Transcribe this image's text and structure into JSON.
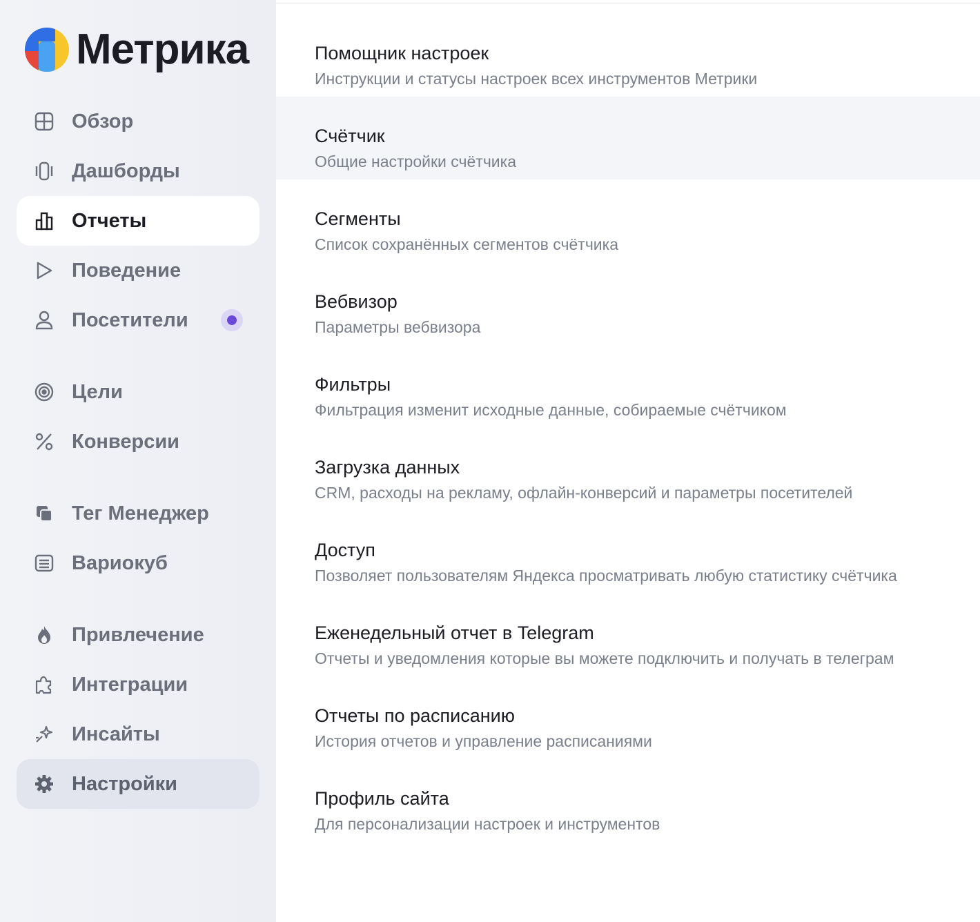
{
  "app": {
    "logo_text": "Метрика"
  },
  "sidebar": {
    "items": [
      {
        "label": "Обзор",
        "icon": "grid-icon"
      },
      {
        "label": "Дашборды",
        "icon": "dashboards-icon"
      },
      {
        "label": "Отчеты",
        "icon": "bar-chart-icon",
        "state": "active"
      },
      {
        "label": "Поведение",
        "icon": "play-icon"
      },
      {
        "label": "Посетители",
        "icon": "user-icon",
        "badge": true
      },
      {
        "label": "Цели",
        "icon": "target-icon"
      },
      {
        "label": "Конверсии",
        "icon": "percent-icon"
      },
      {
        "label": "Тег Менеджер",
        "icon": "tag-manager-icon"
      },
      {
        "label": "Вариокуб",
        "icon": "variocube-icon"
      },
      {
        "label": "Привлечение",
        "icon": "flame-icon"
      },
      {
        "label": "Интеграции",
        "icon": "puzzle-icon"
      },
      {
        "label": "Инсайты",
        "icon": "sparkle-icon"
      },
      {
        "label": "Настройки",
        "icon": "gear-icon",
        "state": "selected"
      }
    ]
  },
  "settings": {
    "items": [
      {
        "title": "Помощник настроек",
        "subtitle": "Инструкции и статусы настроек всех инструментов Метрики"
      },
      {
        "title": "Счётчик",
        "subtitle": "Общие настройки счётчика"
      },
      {
        "title": "Сегменты",
        "subtitle": "Список сохранённых сегментов счётчика"
      },
      {
        "title": "Вебвизор",
        "subtitle": "Параметры вебвизора"
      },
      {
        "title": "Фильтры",
        "subtitle": "Фильтрация изменит исходные данные, собираемые счётчиком"
      },
      {
        "title": "Загрузка данных",
        "subtitle": "CRM, расходы на рекламу, офлайн-конверсий и параметры посетителей"
      },
      {
        "title": "Доступ",
        "subtitle": "Позволяет пользователям Яндекса просматривать любую статистику счётчика"
      },
      {
        "title": "Еженедельный отчет в Telegram",
        "subtitle": "Отчеты и уведомления которые вы можете подключить и получать в телеграм"
      },
      {
        "title": "Отчеты по расписанию",
        "subtitle": "История отчетов и управление расписаниями"
      },
      {
        "title": "Профиль сайта",
        "subtitle": "Для персонализации настроек и инструментов"
      }
    ]
  },
  "colors": {
    "badge_dot": "#6b4ad8",
    "text_primary": "#1c1d24",
    "text_secondary": "#7a7f8c"
  }
}
